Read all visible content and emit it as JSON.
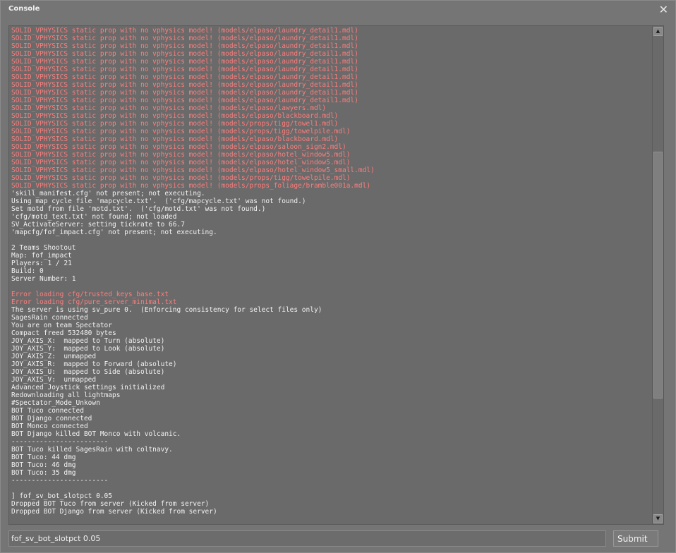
{
  "window": {
    "title": "Console",
    "close_icon": "close-icon"
  },
  "log_lines": [
    {
      "text": "SOLID_VPHYSICS static prop with no vphysics model! (models/elpaso/laundry_detail1.mdl)",
      "error": true
    },
    {
      "text": "SOLID_VPHYSICS static prop with no vphysics model! (models/elpaso/laundry_detail1.mdl)",
      "error": true
    },
    {
      "text": "SOLID_VPHYSICS static prop with no vphysics model! (models/elpaso/laundry_detail1.mdl)",
      "error": true
    },
    {
      "text": "SOLID_VPHYSICS static prop with no vphysics model! (models/elpaso/laundry_detail1.mdl)",
      "error": true
    },
    {
      "text": "SOLID_VPHYSICS static prop with no vphysics model! (models/elpaso/laundry_detail1.mdl)",
      "error": true
    },
    {
      "text": "SOLID_VPHYSICS static prop with no vphysics model! (models/elpaso/laundry_detail1.mdl)",
      "error": true
    },
    {
      "text": "SOLID_VPHYSICS static prop with no vphysics model! (models/elpaso/laundry_detail1.mdl)",
      "error": true
    },
    {
      "text": "SOLID_VPHYSICS static prop with no vphysics model! (models/elpaso/laundry_detail1.mdl)",
      "error": true
    },
    {
      "text": "SOLID_VPHYSICS static prop with no vphysics model! (models/elpaso/laundry_detail1.mdl)",
      "error": true
    },
    {
      "text": "SOLID_VPHYSICS static prop with no vphysics model! (models/elpaso/laundry_detail1.mdl)",
      "error": true
    },
    {
      "text": "SOLID_VPHYSICS static prop with no vphysics model! (models/elpaso/lawyers.mdl)",
      "error": true
    },
    {
      "text": "SOLID_VPHYSICS static prop with no vphysics model! (models/elpaso/blackboard.mdl)",
      "error": true
    },
    {
      "text": "SOLID_VPHYSICS static prop with no vphysics model! (models/props/tigg/towel1.mdl)",
      "error": true
    },
    {
      "text": "SOLID_VPHYSICS static prop with no vphysics model! (models/props/tigg/towelpile.mdl)",
      "error": true
    },
    {
      "text": "SOLID_VPHYSICS static prop with no vphysics model! (models/elpaso/blackboard.mdl)",
      "error": true
    },
    {
      "text": "SOLID_VPHYSICS static prop with no vphysics model! (models/elpaso/saloon_sign2.mdl)",
      "error": true
    },
    {
      "text": "SOLID_VPHYSICS static prop with no vphysics model! (models/elpaso/hotel_window5.mdl)",
      "error": true
    },
    {
      "text": "SOLID_VPHYSICS static prop with no vphysics model! (models/elpaso/hotel_window5.mdl)",
      "error": true
    },
    {
      "text": "SOLID_VPHYSICS static prop with no vphysics model! (models/elpaso/hotel_window5_small.mdl)",
      "error": true
    },
    {
      "text": "SOLID_VPHYSICS static prop with no vphysics model! (models/props/tigg/towelpile.mdl)",
      "error": true
    },
    {
      "text": "SOLID_VPHYSICS static prop with no vphysics model! (models/props_foliage/bramble001a.mdl)",
      "error": true
    },
    {
      "text": "'skill_manifest.cfg' not present; not executing.",
      "error": false
    },
    {
      "text": "Using map cycle file 'mapcycle.txt'.  ('cfg/mapcycle.txt' was not found.)",
      "error": false
    },
    {
      "text": "Set motd from file 'motd.txt'.  ('cfg/motd.txt' was not found.)",
      "error": false
    },
    {
      "text": "'cfg/motd_text.txt' not found; not loaded",
      "error": false
    },
    {
      "text": "SV_ActivateServer: setting tickrate to 66.7",
      "error": false
    },
    {
      "text": "'mapcfg/fof_impact.cfg' not present; not executing.",
      "error": false
    },
    {
      "text": "",
      "error": false
    },
    {
      "text": "2 Teams Shootout",
      "error": false
    },
    {
      "text": "Map: fof_impact",
      "error": false
    },
    {
      "text": "Players: 1 / 21",
      "error": false
    },
    {
      "text": "Build: 0",
      "error": false
    },
    {
      "text": "Server Number: 1",
      "error": false
    },
    {
      "text": "",
      "error": false
    },
    {
      "text": "Error loading cfg/trusted_keys_base.txt",
      "error": true
    },
    {
      "text": "Error loading cfg/pure_server_minimal.txt",
      "error": true
    },
    {
      "text": "The server is using sv_pure 0.  (Enforcing consistency for select files only)",
      "error": false
    },
    {
      "text": "SagesRain connected",
      "error": false
    },
    {
      "text": "You are on team Spectator",
      "error": false
    },
    {
      "text": "Compact freed 532480 bytes",
      "error": false
    },
    {
      "text": "JOY_AXIS_X:  mapped to Turn (absolute)",
      "error": false
    },
    {
      "text": "JOY_AXIS_Y:  mapped to Look (absolute)",
      "error": false
    },
    {
      "text": "JOY_AXIS_Z:  unmapped",
      "error": false
    },
    {
      "text": "JOY_AXIS_R:  mapped to Forward (absolute)",
      "error": false
    },
    {
      "text": "JOY_AXIS_U:  mapped to Side (absolute)",
      "error": false
    },
    {
      "text": "JOY_AXIS_V:  unmapped",
      "error": false
    },
    {
      "text": "Advanced Joystick settings initialized",
      "error": false
    },
    {
      "text": "Redownloading all lightmaps",
      "error": false
    },
    {
      "text": "#Spectator_Mode_Unkown",
      "error": false
    },
    {
      "text": "BOT Tuco connected",
      "error": false
    },
    {
      "text": "BOT Django connected",
      "error": false
    },
    {
      "text": "BOT Monco connected",
      "error": false
    },
    {
      "text": "BOT Django killed BOT Monco with volcanic.",
      "error": false
    },
    {
      "text": "------------------------",
      "error": false
    },
    {
      "text": "BOT Tuco killed SagesRain with coltnavy.",
      "error": false
    },
    {
      "text": "BOT Tuco: 44 dmg",
      "error": false
    },
    {
      "text": "BOT Tuco: 46 dmg",
      "error": false
    },
    {
      "text": "BOT Tuco: 35 dmg",
      "error": false
    },
    {
      "text": "------------------------",
      "error": false
    },
    {
      "text": "",
      "error": false
    },
    {
      "text": "] fof_sv_bot_slotpct 0.05",
      "error": false
    },
    {
      "text": "Dropped BOT Tuco from server (Kicked from server)",
      "error": false
    },
    {
      "text": "Dropped BOT Django from server (Kicked from server)",
      "error": false
    }
  ],
  "scrollbar": {
    "up_icon": "▲",
    "down_icon": "▼",
    "position": 0.5
  },
  "command": {
    "value": "fof_sv_bot_slotpct 0.05",
    "submit_label": "Submit"
  },
  "colors": {
    "error_text": "#ff7d7d",
    "normal_text": "#f2f2f2",
    "background": "#757575"
  }
}
